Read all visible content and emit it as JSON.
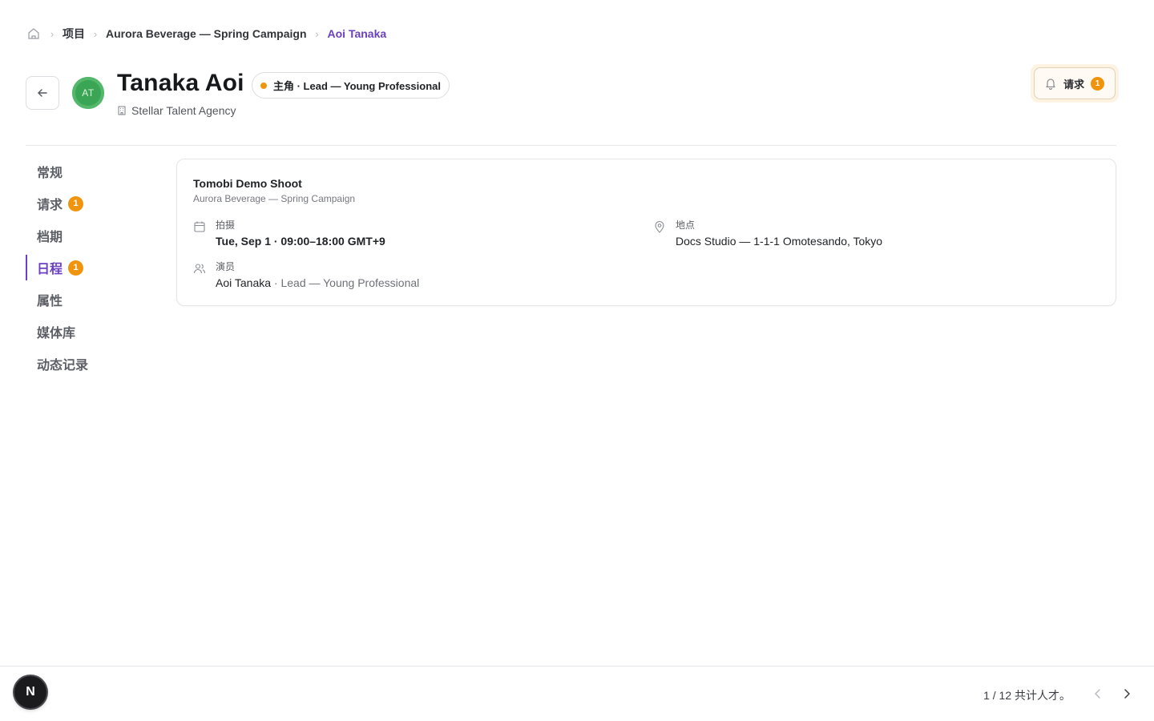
{
  "breadcrumb": {
    "home_icon": "home-icon",
    "items": [
      "项目",
      "Aurora Beverage — Spring Campaign",
      "Aoi Tanaka"
    ]
  },
  "profile": {
    "avatar_initials": "AT",
    "name": "Tanaka Aoi",
    "role_badge": "主角 · Lead — Young Professional",
    "role_dot_color": "#f0940e",
    "agency": "Stellar Talent Agency"
  },
  "requests_button": {
    "label": "请求",
    "count": "1"
  },
  "sidenav": {
    "items": [
      {
        "label": "常规"
      },
      {
        "label": "请求",
        "badge": "1"
      },
      {
        "label": "档期"
      },
      {
        "label": "日程",
        "badge": "1",
        "active": true
      },
      {
        "label": "属性"
      },
      {
        "label": "媒体库"
      },
      {
        "label": "动态记录"
      }
    ]
  },
  "schedule_card": {
    "title": "Tomobi Demo Shoot",
    "subtitle": "Aurora Beverage — Spring Campaign",
    "shoot": {
      "label": "拍摄",
      "value": "Tue, Sep 1 · 09:00–18:00 GMT+9"
    },
    "location": {
      "label": "地点",
      "value": "Docs Studio — 1-1-1 Omotesando, Tokyo"
    },
    "cast": {
      "label": "演员",
      "name": "Aoi Tanaka",
      "role": " · Lead — Young Professional"
    }
  },
  "footer": {
    "logo_letter": "N",
    "pager_text": "1 / 12 共计人才。"
  },
  "colors": {
    "accent": "#6b40c2",
    "badge": "#f0940e"
  }
}
